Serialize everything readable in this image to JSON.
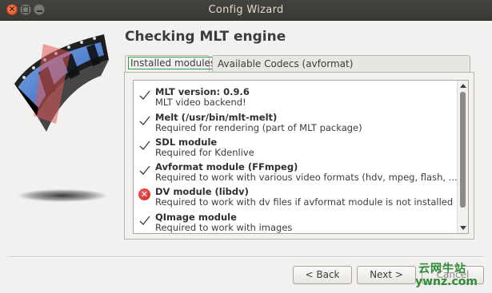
{
  "window": {
    "title": "Config Wizard"
  },
  "page": {
    "heading": "Checking MLT engine"
  },
  "tabs": [
    {
      "label": "Installed modules",
      "active": true
    },
    {
      "label": "Available Codecs (avformat)",
      "active": false
    }
  ],
  "modules": [
    {
      "name": "MLT version: 0.9.6",
      "description": "MLT video backend!",
      "status": "ok",
      "icon": "check-icon"
    },
    {
      "name": "Melt (/usr/bin/mlt-melt)",
      "description": "Required for rendering (part of MLT package)",
      "status": "ok",
      "icon": "check-icon"
    },
    {
      "name": "SDL module",
      "description": "Required for Kdenlive",
      "status": "ok",
      "icon": "check-icon"
    },
    {
      "name": "Avformat module (FFmpeg)",
      "description": "Required to work with various video formats (hdv, mpeg, flash, ...)",
      "status": "ok",
      "icon": "check-icon"
    },
    {
      "name": "DV module (libdv)",
      "description": "Required to work with dv files if avformat module is not installed",
      "status": "error",
      "icon": "error-icon"
    },
    {
      "name": "QImage module",
      "description": "Required to work with images",
      "status": "ok",
      "icon": "check-icon"
    }
  ],
  "buttons": {
    "back": "< Back",
    "next": "Next >",
    "cancel": "Cancel"
  },
  "watermark": {
    "line1": "云网牛站",
    "line2": "ywnz.com"
  },
  "colors": {
    "titlebar": "#3a3934",
    "window_bg": "#f2f1f0",
    "close_button": "#e2531f",
    "error": "#c9201e",
    "watermark": "#2e8b3a"
  }
}
